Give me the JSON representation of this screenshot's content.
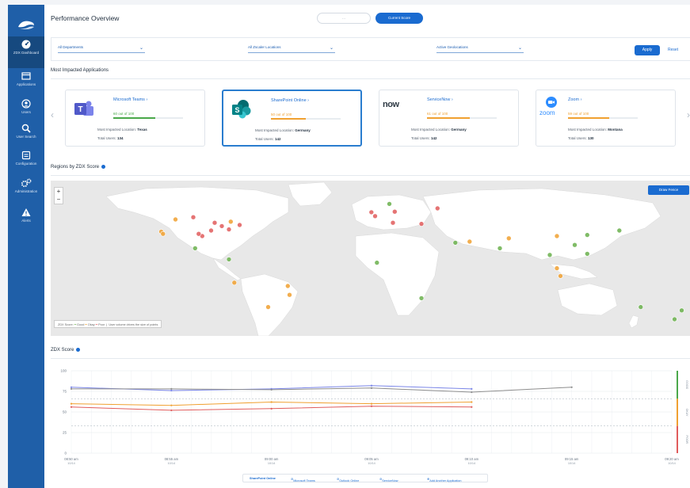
{
  "sidebar": {
    "items": [
      {
        "label": "ZDX Dashboard",
        "icon": "dashboard-icon"
      },
      {
        "label": "Applications",
        "icon": "applications-icon"
      },
      {
        "label": "Users",
        "icon": "users-icon"
      },
      {
        "label": "User Search",
        "icon": "search-icon"
      },
      {
        "label": "Configuration",
        "icon": "configuration-icon"
      },
      {
        "label": "Administration",
        "icon": "administration-icon"
      },
      {
        "label": "Alerts",
        "icon": "alert-icon"
      }
    ]
  },
  "header": {
    "title": "Performance Overview",
    "time_select": "- -",
    "current_score_label": "Current Score"
  },
  "filters": {
    "departments": "All Departments",
    "locations": "All Zscaler Locations",
    "geolocations": "Active Geolocations",
    "apply_label": "Apply",
    "reset_label": "Reset"
  },
  "most_impacted": {
    "title": "Most Impacted Applications",
    "cards": [
      {
        "name": "Microsoft Teams ›",
        "score": "60 out of 100",
        "score_pct": 60,
        "score_color": "#4aa84a",
        "location_label": "Most Impacted Location:",
        "location": "Texas",
        "users_label": "Total Users:",
        "users": "134"
      },
      {
        "name": "SharePoint Online ›",
        "score": "50 out of 100",
        "score_pct": 50,
        "score_color": "#f0a030",
        "location_label": "Most Impacted Location:",
        "location": "Germany",
        "users_label": "Total Users:",
        "users": "142"
      },
      {
        "name": "ServiceNow ›",
        "score": "61 out of 100",
        "score_pct": 61,
        "score_color": "#f0a030",
        "location_label": "Most Impacted Location:",
        "location": "Germany",
        "users_label": "Total Users:",
        "users": "142",
        "logo_text": "now"
      },
      {
        "name": "Zoom ›",
        "score": "59 out of 100",
        "score_pct": 59,
        "score_color": "#f0a030",
        "location_label": "Most Impacted Location:",
        "location": "Montana",
        "users_label": "Total Users:",
        "users": "130",
        "logo_text": "zoom"
      }
    ]
  },
  "regions": {
    "title": "Regions by ZDX Score",
    "draw_fence_label": "Draw Fence",
    "zoom_in": "+",
    "zoom_out": "−",
    "legend_title": "ZDX Score:",
    "legend_good": "Good",
    "legend_okay": "Okay",
    "legend_poor": "Poor",
    "legend_note": "User volume drives the size of points",
    "colors": {
      "good": "#6ab04c",
      "okay": "#f0a030",
      "poor": "#e05c5c"
    }
  },
  "zdx_chart": {
    "title": "ZDX Score",
    "side_labels": [
      "GOOD",
      "OKAY",
      "POOR"
    ]
  },
  "chart_data": {
    "type": "line",
    "title": "ZDX Score",
    "ylim": [
      0,
      100
    ],
    "y_ticks": [
      "0",
      "25",
      "50",
      "75",
      "100"
    ],
    "x_ticks": [
      {
        "time": "08:50 am",
        "date": "10/14"
      },
      {
        "time": "08:55 am",
        "date": "10/14"
      },
      {
        "time": "09:00 am",
        "date": "10/14"
      },
      {
        "time": "09:05 am",
        "date": "10/14"
      },
      {
        "time": "09:10 am",
        "date": "10/14"
      },
      {
        "time": "09:15 am",
        "date": "10/14"
      },
      {
        "time": "09:20 am",
        "date": "10/14"
      }
    ],
    "series": [
      {
        "name": "SharePoint Online",
        "color": "#7b86e8",
        "x": [
          0,
          1,
          2,
          3,
          4
        ],
        "values": [
          80,
          76,
          78,
          82,
          78
        ]
      },
      {
        "name": "Microsoft Teams",
        "color": "#8d8d8d",
        "x": [
          0,
          1,
          2,
          3,
          4,
          5
        ],
        "values": [
          78,
          78,
          77,
          79,
          74,
          80
        ]
      },
      {
        "name": "Outlook Online",
        "color": "#f0a030",
        "x": [
          0,
          1,
          2,
          3,
          4
        ],
        "values": [
          60,
          58,
          62,
          60,
          62
        ]
      },
      {
        "name": "ServiceNow",
        "color": "#e05c5c",
        "x": [
          0,
          1,
          2,
          3,
          4
        ],
        "values": [
          56,
          52,
          54,
          57,
          56
        ]
      }
    ],
    "thresholds": [
      66,
      33
    ],
    "grid": true
  },
  "bottom_legend": {
    "items": [
      "SharePoint Online",
      "Microsoft Teams",
      "Outlook Online",
      "ServiceNow"
    ],
    "add_label": "Add Another Application"
  },
  "map_points": [
    {
      "lon": -118,
      "lat": 34,
      "s": "okay"
    },
    {
      "lon": -110,
      "lat": 45,
      "s": "okay"
    },
    {
      "lon": -100,
      "lat": 47,
      "s": "poor"
    },
    {
      "lon": -88,
      "lat": 42,
      "s": "poor"
    },
    {
      "lon": -84,
      "lat": 39,
      "s": "poor"
    },
    {
      "lon": -80,
      "lat": 36,
      "s": "poor"
    },
    {
      "lon": -74,
      "lat": 40,
      "s": "poor"
    },
    {
      "lon": -79,
      "lat": 43,
      "s": "okay"
    },
    {
      "lon": -90,
      "lat": 35,
      "s": "poor"
    },
    {
      "lon": -95,
      "lat": 30,
      "s": "poor"
    },
    {
      "lon": -117,
      "lat": 32,
      "s": "okay"
    },
    {
      "lon": -97,
      "lat": 32,
      "s": "poor"
    },
    {
      "lon": -99,
      "lat": 19,
      "s": "good"
    },
    {
      "lon": -80,
      "lat": 9,
      "s": "good"
    },
    {
      "lon": -77,
      "lat": -12,
      "s": "okay"
    },
    {
      "lon": -47,
      "lat": -15,
      "s": "okay"
    },
    {
      "lon": -58,
      "lat": -34,
      "s": "okay"
    },
    {
      "lon": -46,
      "lat": -23,
      "s": "okay"
    },
    {
      "lon": -0.1,
      "lat": 51.5,
      "s": "poor"
    },
    {
      "lon": 2,
      "lat": 48,
      "s": "poor"
    },
    {
      "lon": 13,
      "lat": 52,
      "s": "poor"
    },
    {
      "lon": 10,
      "lat": 59,
      "s": "good"
    },
    {
      "lon": 37,
      "lat": 55,
      "s": "poor"
    },
    {
      "lon": 12,
      "lat": 42,
      "s": "poor"
    },
    {
      "lon": 28,
      "lat": 41,
      "s": "poor"
    },
    {
      "lon": 55,
      "lat": 25,
      "s": "okay"
    },
    {
      "lon": 47,
      "lat": 24,
      "s": "good"
    },
    {
      "lon": 72,
      "lat": 19,
      "s": "good"
    },
    {
      "lon": 77,
      "lat": 28,
      "s": "okay"
    },
    {
      "lon": 100,
      "lat": 13,
      "s": "good"
    },
    {
      "lon": 104,
      "lat": 1,
      "s": "okay"
    },
    {
      "lon": 106,
      "lat": -6,
      "s": "okay"
    },
    {
      "lon": 114,
      "lat": 22,
      "s": "good"
    },
    {
      "lon": 121,
      "lat": 31,
      "s": "good"
    },
    {
      "lon": 121,
      "lat": 14,
      "s": "good"
    },
    {
      "lon": 139,
      "lat": 35,
      "s": "good"
    },
    {
      "lon": 104,
      "lat": 30,
      "s": "okay"
    },
    {
      "lon": 151,
      "lat": -34,
      "s": "good"
    },
    {
      "lon": 174,
      "lat": -37,
      "s": "good"
    },
    {
      "lon": 170,
      "lat": -45,
      "s": "good"
    },
    {
      "lon": 3,
      "lat": 6,
      "s": "good"
    },
    {
      "lon": 28,
      "lat": -26,
      "s": "good"
    }
  ]
}
